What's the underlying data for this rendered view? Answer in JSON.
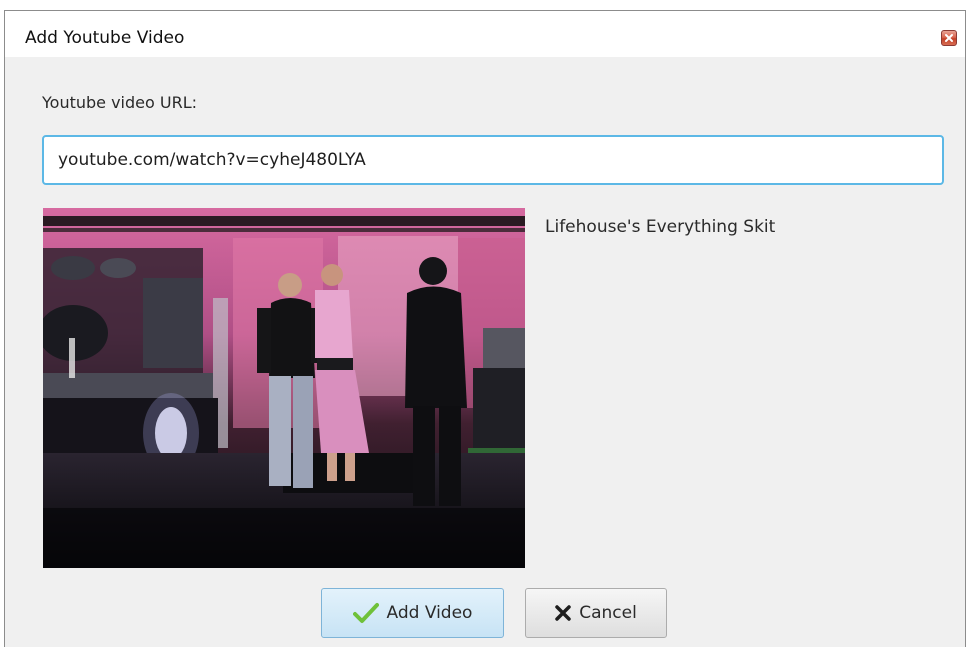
{
  "dialog": {
    "title": "Add Youtube Video",
    "close_icon": "close-icon"
  },
  "form": {
    "url_label": "Youtube video URL:",
    "url_value": "youtube.com/watch?v=cyheJ480LYA"
  },
  "preview": {
    "video_title": "Lifehouse's Everything Skit"
  },
  "buttons": {
    "add_label": "Add Video",
    "add_icon": "checkmark-icon",
    "cancel_label": "Cancel",
    "cancel_icon": "x-icon"
  },
  "colors": {
    "input_focus_border": "#5cb8e6",
    "add_button_bg": "#d4eaf8",
    "close_button": "#c9452f",
    "check_green": "#6fc13a"
  }
}
